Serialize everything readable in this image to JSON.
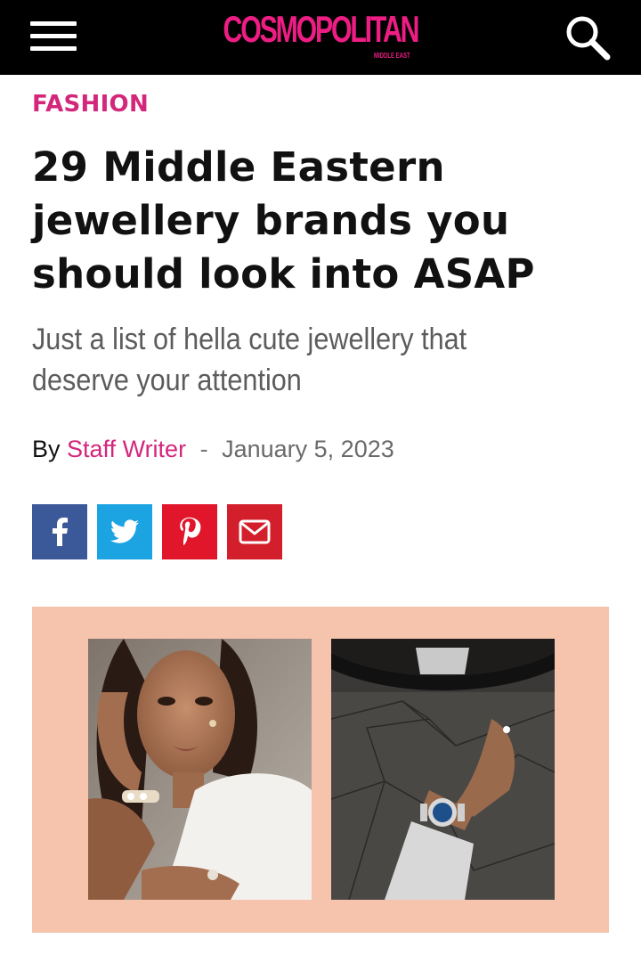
{
  "header": {
    "logo": "COSMOPOLITAN",
    "logo_subtitle": "MIDDLE EAST",
    "menu_icon": "hamburger-menu-icon",
    "search_icon": "search-icon",
    "background": "#000000",
    "brand_color": "#ee1d84"
  },
  "article": {
    "category": "FASHION",
    "headline_lines": [
      "29 Middle Eastern",
      "jewellery brands you",
      "should look into ASAP"
    ],
    "dek_lines": [
      "Just a list of hella cute jewellery that",
      "deserve your attention"
    ],
    "byline": {
      "prefix": "By",
      "author": "Staff Writer",
      "separator": "-",
      "date": "January 5, 2023"
    }
  },
  "share_buttons": [
    {
      "icon": "facebook-icon",
      "color": "#3b5898"
    },
    {
      "icon": "twitter-icon",
      "color": "#1ca3e2"
    },
    {
      "icon": "pinterest-icon",
      "color": "#e1162b"
    },
    {
      "icon": "email-icon",
      "color": "#d31f2b"
    }
  ],
  "hero": {
    "background": "#f6c3ad",
    "images": [
      "woman-wearing-jewellery-photo",
      "wrist-watch-steering-wheel-photo"
    ]
  }
}
